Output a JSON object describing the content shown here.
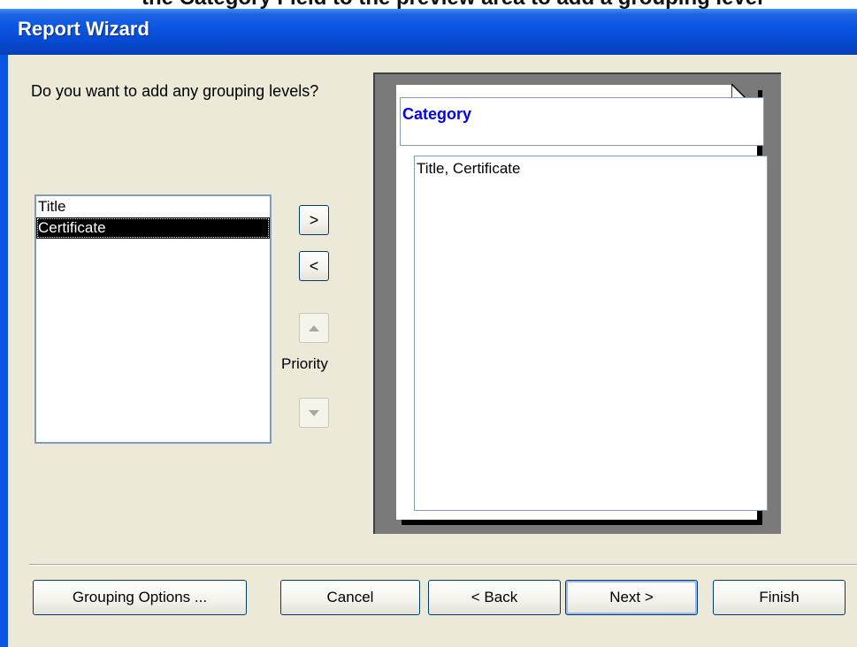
{
  "caption_fragment": "the Category Field to the preview area to add a grouping level",
  "window": {
    "title": "Report Wizard"
  },
  "question": "Do you want to add any grouping levels?",
  "fields": [
    "Title",
    "Certificate"
  ],
  "selected_field": "Certificate",
  "move_buttons": {
    "add": ">",
    "remove": "<"
  },
  "priority_label": "Priority",
  "preview": {
    "group_header": "Category",
    "detail": "Title, Certificate"
  },
  "buttons": {
    "grouping_options": "Grouping Options ...",
    "cancel": "Cancel",
    "back": "< Back",
    "next": "Next >",
    "finish": "Finish"
  },
  "colors": {
    "titlebar": "#0a55e4",
    "dialog_bg": "#ece9d8",
    "header_text": "#0000ff"
  }
}
